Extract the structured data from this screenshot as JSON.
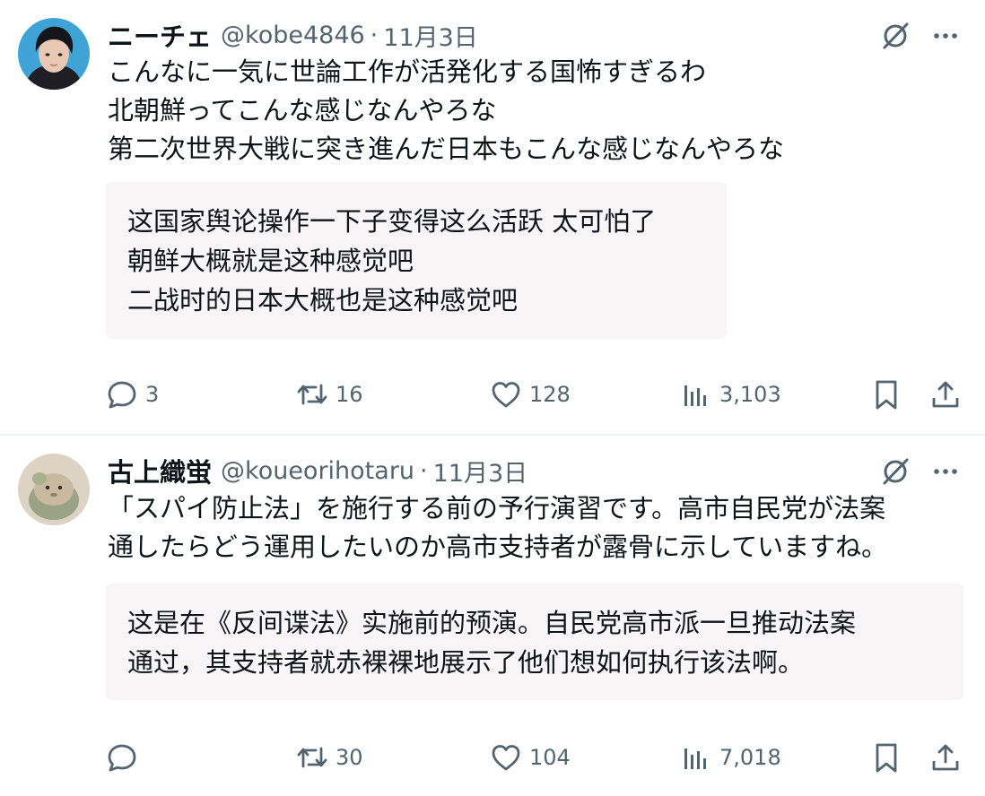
{
  "tweets": [
    {
      "display_name": "ニーチェ",
      "handle": "@kobe4846",
      "separator": "·",
      "date": "11月3日",
      "text_lines": [
        "こんなに一気に世論工作が活発化する国怖すぎるわ",
        "北朝鮮ってこんな感じなんやろな",
        "第二次世界大戦に突き進んだ日本もこんな感じなんやろな"
      ],
      "translation_lines": [
        "这国家舆论操作一下子变得这么活跃 太可怕了",
        "朝鲜大概就是这种感觉吧",
        "二战时的日本大概也是这种感觉吧"
      ],
      "stats": {
        "replies": "3",
        "retweets": "16",
        "likes": "128",
        "views": "3,103"
      },
      "avatar": "portrait-photo"
    },
    {
      "display_name": "古上織蛍",
      "handle": "@koueorihotaru",
      "separator": "·",
      "date": "11月3日",
      "text_lines": [
        "「スパイ防止法」を施行する前の予行演習です。高市自民党が法案",
        "通したらどう運用したいのか高市支持者が露骨に示していますね。"
      ],
      "translation_lines": [
        "这是在《反间谍法》实施前的预演。自民党高市派一旦推动法案",
        "通过，其支持者就赤裸裸地展示了他们想如何执行该法啊。"
      ],
      "stats": {
        "replies": "",
        "retweets": "30",
        "likes": "104",
        "views": "7,018"
      },
      "avatar": "plush-toy-photo"
    }
  ],
  "icons": [
    "grok-icon",
    "more-icon",
    "reply-icon",
    "retweet-icon",
    "like-icon",
    "views-icon",
    "bookmark-icon",
    "share-icon"
  ],
  "colors": {
    "text": "#0f1419",
    "secondary": "#536471",
    "translation_bg": "#f7f5f5",
    "divider": "#eff3f4"
  }
}
